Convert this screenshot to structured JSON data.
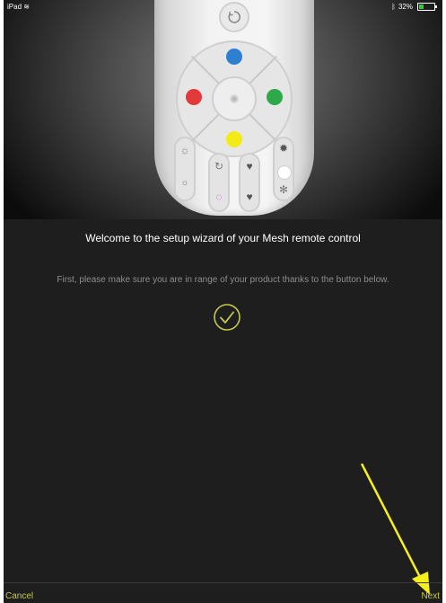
{
  "status_bar": {
    "device": "iPad",
    "battery": "32%",
    "battery_color": "#2dcc3a"
  },
  "wizard": {
    "title": "Welcome to the setup wizard of your Mesh remote control",
    "instruction": "First, please make sure you are in range of your product thanks to the button below.",
    "check_icon": "checkmark-circle-icon"
  },
  "footer": {
    "cancel_label": "Cancel",
    "next_label": "Next"
  },
  "colors": {
    "background": "#1e1e1e",
    "accent": "#c6c84a",
    "annotation_arrow": "#f5ef1c",
    "remote_blue": "#2f7fd1",
    "remote_red": "#e23a3a",
    "remote_green": "#2fa84a",
    "remote_yellow": "#f3ea16"
  }
}
